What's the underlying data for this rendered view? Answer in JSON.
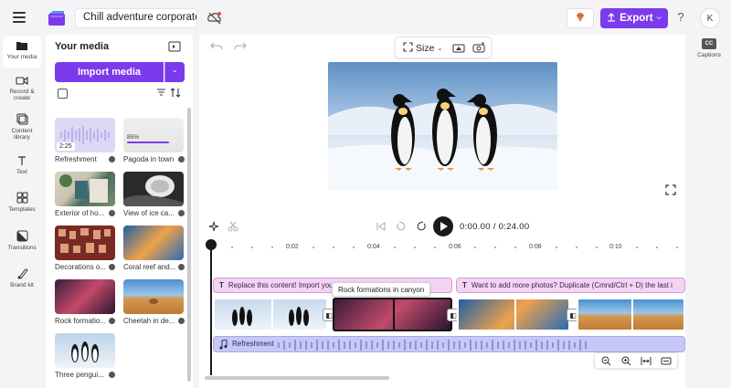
{
  "topbar": {
    "project_title": "Chill adventure corporate sli",
    "export_label": "Export",
    "help_label": "?",
    "avatar_initial": "K"
  },
  "nav": [
    {
      "label": "Your media",
      "icon": "folder-icon"
    },
    {
      "label": "Record & create",
      "icon": "video-camera-icon"
    },
    {
      "label": "Content library",
      "icon": "library-icon"
    },
    {
      "label": "Text",
      "icon": "text-icon"
    },
    {
      "label": "Templates",
      "icon": "templates-icon"
    },
    {
      "label": "Transitions",
      "icon": "transitions-icon"
    },
    {
      "label": "Brand kit",
      "icon": "brand-kit-icon"
    }
  ],
  "media": {
    "title": "Your media",
    "import_label": "Import media",
    "items": [
      {
        "label": "Refreshment",
        "badge": "2:25"
      },
      {
        "label": "Pagoda in town",
        "progress": "85%"
      },
      {
        "label": "Exterior of ho..."
      },
      {
        "label": "View of ice ca..."
      },
      {
        "label": "Decorations o..."
      },
      {
        "label": "Coral reef and..."
      },
      {
        "label": "Rock formatio..."
      },
      {
        "label": "Cheetah in de..."
      },
      {
        "label": "Three pengui..."
      }
    ]
  },
  "preview": {
    "size_label": "Size"
  },
  "captions": {
    "label": "Captions"
  },
  "timeline": {
    "timecode": "0:00.00 / 0:24.00",
    "ticks": [
      "0:02",
      "0:04",
      "0:06",
      "0:08",
      "0:10"
    ],
    "text_clip_1": "Replace this content! Import your own media",
    "text_clip_2": "Want to add more photos? Duplicate (Cmnd/Ctrl + D) the last i",
    "tooltip": "Rock formations in canyon",
    "audio_label": "Refreshment"
  },
  "colors": {
    "accent": "#7c3aed",
    "text_clip": "#f3d5f3",
    "audio_clip": "#c7c8f5"
  }
}
